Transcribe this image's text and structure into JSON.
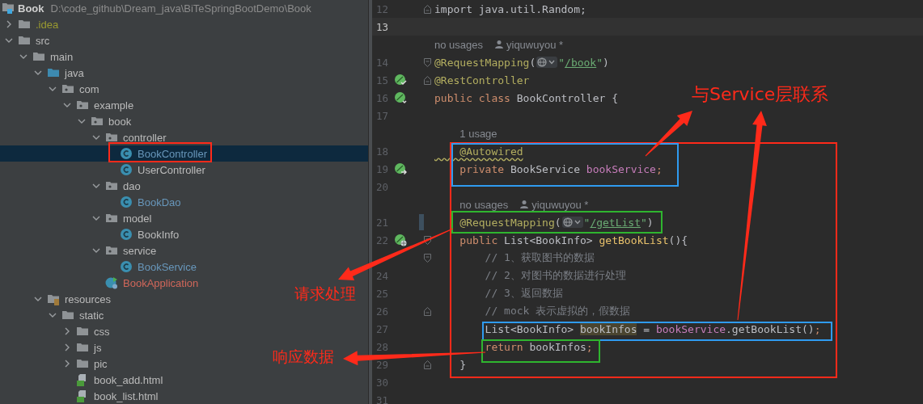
{
  "project": {
    "name": "Book",
    "path": "D:\\code_github\\Dream_java\\BiTeSpringBootDemo\\Book"
  },
  "tree": [
    {
      "label": ".idea",
      "kind": "folder",
      "color": "#9a9a30",
      "expanded": false,
      "selected": false
    },
    {
      "label": "src",
      "kind": "folder",
      "color": "#bbbbbb",
      "expanded": true,
      "selected": false,
      "children": [
        {
          "label": "main",
          "kind": "folder",
          "color": "#bbbbbb",
          "expanded": true,
          "selected": false,
          "children": [
            {
              "label": "java",
              "kind": "source",
              "color": "#bbbbbb",
              "expanded": true,
              "selected": false,
              "children": [
                {
                  "label": "com",
                  "kind": "package",
                  "color": "#bbbbbb",
                  "expanded": true,
                  "selected": false,
                  "children": [
                    {
                      "label": "example",
                      "kind": "package",
                      "color": "#bbbbbb",
                      "expanded": true,
                      "selected": false,
                      "children": [
                        {
                          "label": "book",
                          "kind": "package",
                          "color": "#bbbbbb",
                          "expanded": true,
                          "selected": false,
                          "children": [
                            {
                              "label": "controller",
                              "kind": "package",
                              "color": "#bbbbbb",
                              "expanded": true,
                              "selected": false,
                              "children": [
                                {
                                  "label": "BookController",
                                  "kind": "class",
                                  "color": "#6897bb",
                                  "selected": true
                                },
                                {
                                  "label": "UserController",
                                  "kind": "class",
                                  "color": "#bbbbbb",
                                  "selected": false
                                }
                              ]
                            },
                            {
                              "label": "dao",
                              "kind": "package",
                              "color": "#bbbbbb",
                              "expanded": true,
                              "selected": false,
                              "children": [
                                {
                                  "label": "BookDao",
                                  "kind": "class",
                                  "color": "#6897bb",
                                  "selected": false
                                }
                              ]
                            },
                            {
                              "label": "model",
                              "kind": "package",
                              "color": "#bbbbbb",
                              "expanded": true,
                              "selected": false,
                              "children": [
                                {
                                  "label": "BookInfo",
                                  "kind": "class",
                                  "color": "#bbbbbb",
                                  "selected": false
                                }
                              ]
                            },
                            {
                              "label": "service",
                              "kind": "package",
                              "color": "#bbbbbb",
                              "expanded": true,
                              "selected": false,
                              "children": [
                                {
                                  "label": "BookService",
                                  "kind": "class",
                                  "color": "#6897bb",
                                  "selected": false
                                }
                              ]
                            },
                            {
                              "label": "BookApplication",
                              "kind": "app",
                              "color": "#d1675a",
                              "selected": false
                            }
                          ]
                        }
                      ]
                    }
                  ]
                }
              ]
            },
            {
              "label": "resources",
              "kind": "resources",
              "color": "#bbbbbb",
              "expanded": true,
              "selected": false,
              "children": [
                {
                  "label": "static",
                  "kind": "folder",
                  "color": "#bbbbbb",
                  "expanded": true,
                  "selected": false,
                  "children": [
                    {
                      "label": "css",
                      "kind": "folder",
                      "color": "#bbbbbb",
                      "expanded": false,
                      "selected": false
                    },
                    {
                      "label": "js",
                      "kind": "folder",
                      "color": "#bbbbbb",
                      "expanded": false,
                      "selected": false
                    },
                    {
                      "label": "pic",
                      "kind": "folder",
                      "color": "#bbbbbb",
                      "expanded": false,
                      "selected": false
                    },
                    {
                      "label": "book_add.html",
                      "kind": "html",
                      "color": "#bbbbbb",
                      "selected": false
                    },
                    {
                      "label": "book_list.html",
                      "kind": "html",
                      "color": "#bbbbbb",
                      "selected": false
                    }
                  ]
                }
              ]
            }
          ]
        }
      ]
    }
  ],
  "editor": {
    "lines": [
      {
        "kind": "code",
        "number": "12",
        "current": false,
        "changed": false,
        "fold_marker": {
          "kind": "end"
        },
        "tokens": [
          {
            "kind": "plain",
            "text": "import java.util.Random;"
          }
        ]
      },
      {
        "kind": "code",
        "number": "13",
        "current": true,
        "changed": false
      },
      {
        "kind": "inlay",
        "usage": "no usages",
        "author": "yiquwuyou *"
      },
      {
        "kind": "code",
        "number": "14",
        "current": false,
        "changed": false,
        "fold_marker": {
          "kind": "start"
        },
        "tokens": [
          {
            "kind": "ann",
            "text": "@RequestMapping"
          },
          {
            "kind": "plain",
            "text": "("
          },
          {
            "kind": "globe"
          },
          {
            "kind": "str",
            "text": "\""
          },
          {
            "kind": "url",
            "text": "/book"
          },
          {
            "kind": "str",
            "text": "\""
          },
          {
            "kind": "plain",
            "text": ")"
          }
        ]
      },
      {
        "kind": "code",
        "number": "15",
        "current": false,
        "changed": false,
        "fold_marker": {
          "kind": "end"
        },
        "gutter_icon": {
          "kind": "bean-check"
        },
        "tokens": [
          {
            "kind": "ann",
            "text": "@RestController"
          }
        ]
      },
      {
        "kind": "code",
        "number": "16",
        "current": false,
        "changed": false,
        "gutter_icon": {
          "kind": "bean"
        },
        "tokens": [
          {
            "kind": "kw",
            "text": "public class "
          },
          {
            "kind": "plain",
            "text": "BookController {"
          }
        ]
      },
      {
        "kind": "code",
        "number": "17",
        "current": false,
        "changed": false
      },
      {
        "kind": "inlay",
        "usage": "1 usage"
      },
      {
        "kind": "code",
        "number": "18",
        "current": false,
        "changed": false,
        "tokens": [
          {
            "kind": "warn",
            "text": "    @Autowired"
          }
        ]
      },
      {
        "kind": "code",
        "number": "19",
        "current": false,
        "changed": false,
        "gutter_icon": {
          "kind": "bean-arrow"
        },
        "tokens": [
          {
            "kind": "kw",
            "text": "    private "
          },
          {
            "kind": "plain",
            "text": "BookService "
          },
          {
            "kind": "field",
            "text": "bookService"
          },
          {
            "kind": "kw",
            "text": ";"
          }
        ]
      },
      {
        "kind": "code",
        "number": "20",
        "current": false,
        "changed": false
      },
      {
        "kind": "inlay",
        "usage": "no usages",
        "author": "yiquwuyou *"
      },
      {
        "kind": "code",
        "number": "21",
        "current": false,
        "changed": true,
        "tokens": [
          {
            "kind": "ann",
            "text": "    @RequestMapping"
          },
          {
            "kind": "plain",
            "text": "("
          },
          {
            "kind": "globe"
          },
          {
            "kind": "str",
            "text": "\""
          },
          {
            "kind": "url",
            "text": "/getList"
          },
          {
            "kind": "str",
            "text": "\""
          },
          {
            "kind": "plain",
            "text": ")"
          }
        ]
      },
      {
        "kind": "code",
        "number": "22",
        "current": false,
        "changed": false,
        "fold_marker": {
          "kind": "start"
        },
        "gutter_icon": {
          "kind": "bean-globe"
        },
        "tokens": [
          {
            "kind": "kw",
            "text": "    public "
          },
          {
            "kind": "plain",
            "text": "List<BookInfo> "
          },
          {
            "kind": "fn",
            "text": "getBookList"
          },
          {
            "kind": "plain",
            "text": "(){"
          }
        ]
      },
      {
        "kind": "code",
        "fold_marker": {
          "kind": "start"
        },
        "tokens": [
          {
            "kind": "comment",
            "text": "        // 1、获取图书的数据"
          }
        ]
      },
      {
        "kind": "code",
        "number": "24",
        "current": false,
        "changed": false,
        "tokens": [
          {
            "kind": "comment",
            "text": "        // 2、对图书的数据进行处理"
          }
        ]
      },
      {
        "kind": "code",
        "number": "25",
        "current": false,
        "changed": false,
        "tokens": [
          {
            "kind": "comment",
            "text": "        // 3、返回数据"
          }
        ]
      },
      {
        "kind": "code",
        "number": "26",
        "current": false,
        "changed": false,
        "fold_marker": {
          "kind": "end"
        },
        "tokens": [
          {
            "kind": "comment",
            "text": "        // mock 表示虚拟的，假数据"
          }
        ]
      },
      {
        "kind": "code",
        "number": "27",
        "current": false,
        "changed": false,
        "tokens": [
          {
            "kind": "plain",
            "text": "        List<BookInfo> "
          },
          {
            "kind": "hl",
            "text": "bookInfos"
          },
          {
            "kind": "plain",
            "text": " = "
          },
          {
            "kind": "field",
            "text": "bookService"
          },
          {
            "kind": "plain",
            "text": ".getBookList()"
          },
          {
            "kind": "kw",
            "text": ";"
          }
        ]
      },
      {
        "kind": "code",
        "number": "28",
        "current": false,
        "changed": false,
        "tokens": [
          {
            "kind": "kw",
            "text": "        return "
          },
          {
            "kind": "plain",
            "text": "bookInfos"
          },
          {
            "kind": "kw",
            "text": ";"
          }
        ]
      },
      {
        "kind": "code",
        "number": "29",
        "current": false,
        "changed": false,
        "fold_marker": {
          "kind": "end"
        },
        "tokens": [
          {
            "kind": "plain",
            "text": "    }"
          }
        ]
      },
      {
        "kind": "code",
        "number": "30",
        "current": false,
        "changed": false
      },
      {
        "kind": "code",
        "number": "31",
        "current": false,
        "changed": false
      }
    ]
  },
  "annotations": {
    "labels": [
      {
        "text": "与Service层联系"
      },
      {
        "text": "请求处理"
      },
      {
        "text": "响应数据"
      }
    ],
    "boxes": [
      {
        "color": "#ff2a1a"
      },
      {
        "color": "#ff2a1a"
      },
      {
        "color": "#2f9bf0"
      },
      {
        "color": "#2fb52f"
      },
      {
        "color": "#2f9bf0"
      },
      {
        "color": "#2fb52f"
      }
    ]
  }
}
